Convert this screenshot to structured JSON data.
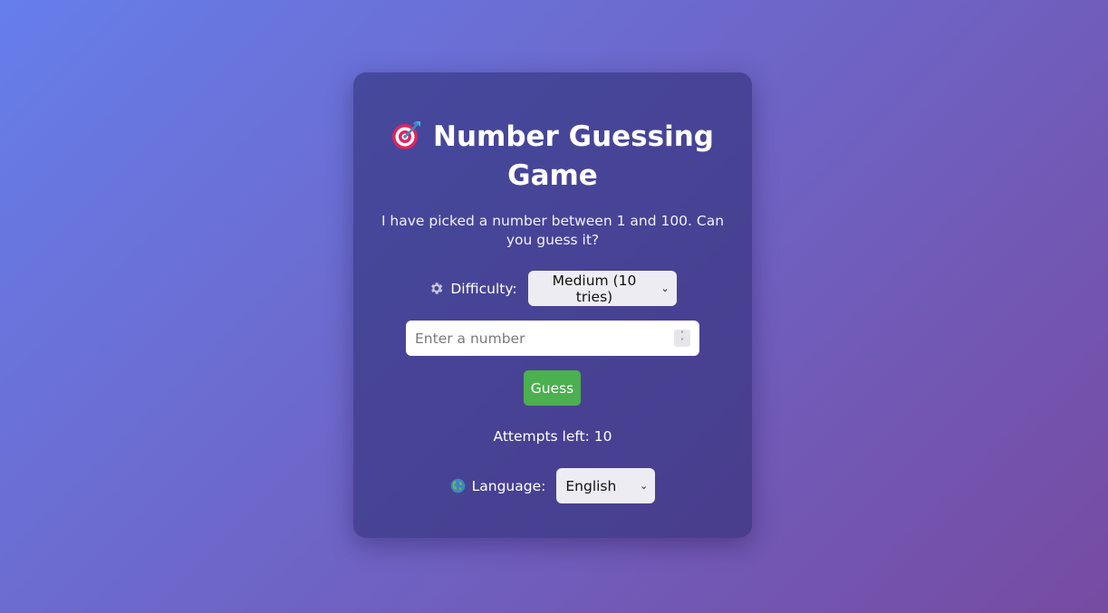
{
  "game": {
    "title": "Number Guessing Game",
    "title_icon": "dart-target-icon",
    "subtitle": "I have picked a number between 1 and 100. Can you guess it?",
    "difficulty": {
      "icon": "gear-icon",
      "label": "Difficulty:",
      "selected": "Medium (10 tries)"
    },
    "guess_input": {
      "value": "",
      "placeholder": "Enter a number"
    },
    "guess_button_label": "Guess",
    "attempts_text": "Attempts left: 10",
    "language": {
      "icon": "globe-icon",
      "label": "Language:",
      "selected": "English"
    }
  },
  "colors": {
    "background_start": "#667eea",
    "background_end": "#764ba2",
    "guess_button": "#4caf50"
  }
}
